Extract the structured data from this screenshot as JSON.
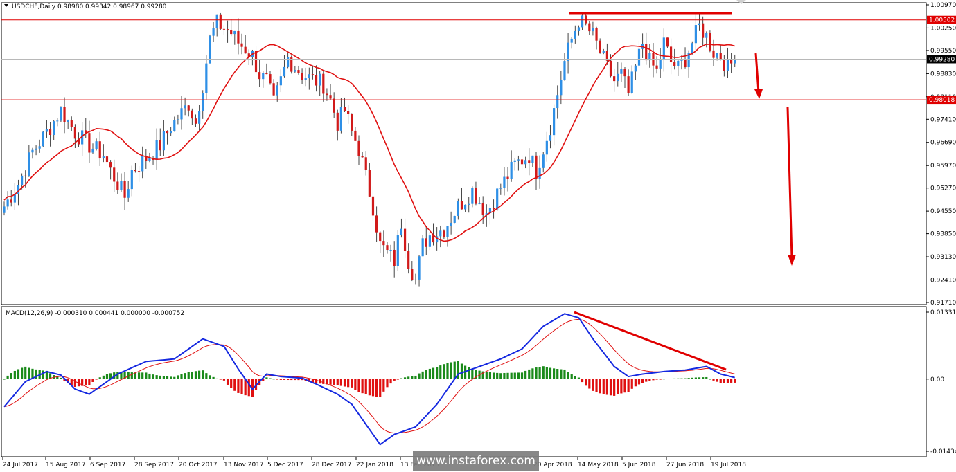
{
  "chart_data": {
    "type": "candlestick",
    "header": {
      "symbol": "USDCHF,Daily",
      "open": "0.98980",
      "high": "0.99342",
      "low": "0.98967",
      "close": "0.99280"
    },
    "price_axis": {
      "ticks": [
        "1.00970",
        "1.00250",
        "0.99550",
        "0.98830",
        "0.98110",
        "0.97410",
        "0.96690",
        "0.95970",
        "0.95270",
        "0.94550",
        "0.93850",
        "0.93130",
        "0.92410",
        "0.91710"
      ],
      "ylim": [
        0.9171,
        1.0097
      ]
    },
    "levels": [
      {
        "value": 1.00502,
        "label": "1.00502",
        "color": "#e00000"
      },
      {
        "value": 0.98018,
        "label": "0.98018",
        "color": "#e00000"
      }
    ],
    "current_price": {
      "value": 0.9928,
      "label": "0.99280"
    },
    "x_labels": [
      "24 Jul 2017",
      "15 Aug 2017",
      "6 Sep 2017",
      "28 Sep 2017",
      "20 Oct 2017",
      "13 Nov 2017",
      "5 Dec 2017",
      "28 Dec 2017",
      "22 Jan 2018",
      "13 Feb 2018",
      "",
      "20 Apr 2018",
      "14 May 2018",
      "5 Jun 2018",
      "27 Jun 2018",
      "19 Jul 2018"
    ],
    "price_path": [
      [
        0,
        0.947
      ],
      [
        4,
        0.954
      ],
      [
        8,
        0.964
      ],
      [
        12,
        0.97
      ],
      [
        16,
        0.977
      ],
      [
        20,
        0.97
      ],
      [
        24,
        0.966
      ],
      [
        28,
        0.963
      ],
      [
        30,
        0.958
      ],
      [
        34,
        0.95
      ],
      [
        36,
        0.958
      ],
      [
        40,
        0.962
      ],
      [
        44,
        0.966
      ],
      [
        47,
        0.972
      ],
      [
        50,
        0.976
      ],
      [
        52,
        0.979
      ],
      [
        54,
        0.973
      ],
      [
        56,
        0.985
      ],
      [
        58,
        0.999
      ],
      [
        60,
        1.004
      ],
      [
        64,
        1.001
      ],
      [
        66,
        0.998
      ],
      [
        70,
        0.994
      ],
      [
        72,
        0.988
      ],
      [
        74,
        0.986
      ],
      [
        76,
        0.979
      ],
      [
        78,
        0.986
      ],
      [
        80,
        0.993
      ],
      [
        84,
        0.988
      ],
      [
        88,
        0.986
      ],
      [
        90,
        0.985
      ],
      [
        92,
        0.98
      ],
      [
        94,
        0.973
      ],
      [
        96,
        0.977
      ],
      [
        98,
        0.97
      ],
      [
        100,
        0.965
      ],
      [
        104,
        0.947
      ],
      [
        106,
        0.935
      ],
      [
        110,
        0.93
      ],
      [
        112,
        0.942
      ],
      [
        114,
        0.93
      ],
      [
        116,
        0.924
      ],
      [
        118,
        0.935
      ],
      [
        120,
        0.938
      ],
      [
        124,
        0.94
      ],
      [
        128,
        0.947
      ],
      [
        132,
        0.952
      ],
      [
        136,
        0.945
      ],
      [
        140,
        0.953
      ],
      [
        144,
        0.96
      ],
      [
        148,
        0.963
      ],
      [
        150,
        0.958
      ],
      [
        154,
        0.972
      ],
      [
        156,
        0.982
      ],
      [
        158,
        0.992
      ],
      [
        160,
        0.999
      ],
      [
        162,
        1.005
      ],
      [
        164,
        1.003
      ],
      [
        166,
        1.0
      ],
      [
        168,
        0.995
      ],
      [
        170,
        0.99
      ],
      [
        172,
        0.986
      ],
      [
        174,
        0.988
      ],
      [
        176,
        0.982
      ],
      [
        178,
        0.99
      ],
      [
        180,
        0.998
      ],
      [
        182,
        0.992
      ],
      [
        184,
        0.989
      ],
      [
        186,
        0.998
      ],
      [
        188,
        0.992
      ],
      [
        190,
        0.99
      ],
      [
        192,
        0.993
      ],
      [
        194,
        0.998
      ],
      [
        196,
        1.003
      ],
      [
        198,
        1.0
      ],
      [
        200,
        0.995
      ],
      [
        202,
        0.994
      ],
      [
        204,
        0.99
      ],
      [
        206,
        0.9928
      ]
    ],
    "ma_label": "",
    "macd": {
      "header": "MACD(12,26,9) -0.000310 0.000441 0.000000 -0.000752",
      "ticks": [
        "0.013313",
        "0.00",
        "-0.01434"
      ],
      "ylim": [
        -0.01434,
        0.013313
      ],
      "macd_path": [
        [
          0,
          -0.0055
        ],
        [
          6,
          -0.0005
        ],
        [
          12,
          0.0015
        ],
        [
          16,
          0.0008
        ],
        [
          20,
          -0.002
        ],
        [
          24,
          -0.003
        ],
        [
          28,
          -0.001
        ],
        [
          32,
          0.001
        ],
        [
          40,
          0.0035
        ],
        [
          48,
          0.004
        ],
        [
          56,
          0.008
        ],
        [
          62,
          0.0065
        ],
        [
          66,
          0.002
        ],
        [
          70,
          -0.002
        ],
        [
          74,
          0.001
        ],
        [
          78,
          0.0005
        ],
        [
          84,
          0.0002
        ],
        [
          88,
          -0.001
        ],
        [
          94,
          -0.003
        ],
        [
          98,
          -0.005
        ],
        [
          102,
          -0.009
        ],
        [
          106,
          -0.013
        ],
        [
          110,
          -0.011
        ],
        [
          116,
          -0.0095
        ],
        [
          122,
          -0.005
        ],
        [
          128,
          0.001
        ],
        [
          134,
          0.0025
        ],
        [
          140,
          0.004
        ],
        [
          146,
          0.006
        ],
        [
          152,
          0.0105
        ],
        [
          158,
          0.013
        ],
        [
          162,
          0.0122
        ],
        [
          166,
          0.008
        ],
        [
          172,
          0.0025
        ],
        [
          176,
          0.0005
        ],
        [
          180,
          0.001
        ],
        [
          186,
          0.0015
        ],
        [
          192,
          0.0018
        ],
        [
          198,
          0.0025
        ],
        [
          202,
          0.001
        ],
        [
          206,
          0.0003
        ]
      ],
      "hist_pattern": "green/red alternating bars around zero"
    },
    "watermark": "www.instaforex.com"
  }
}
